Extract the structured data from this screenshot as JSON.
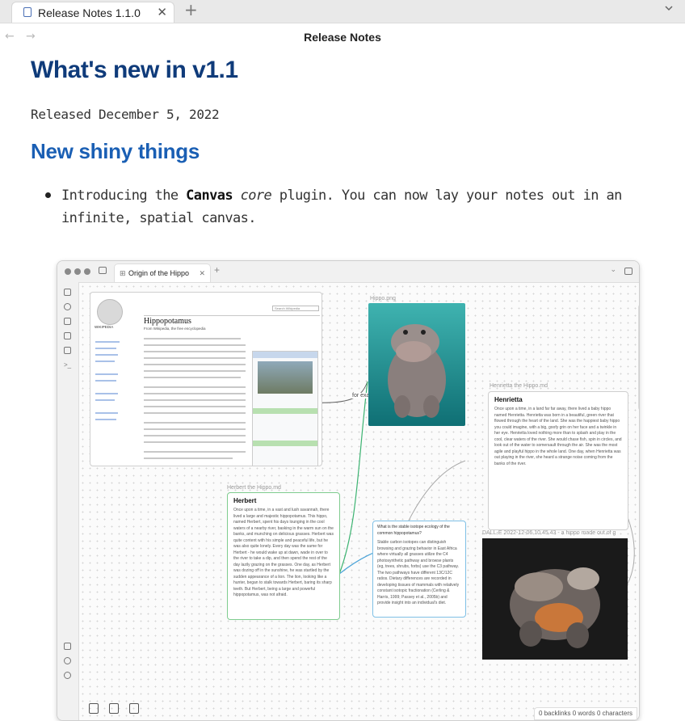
{
  "tab": {
    "title": "Release Notes 1.1.0",
    "close": "✕",
    "new": "+"
  },
  "nav": {
    "back": "←",
    "forward": "→",
    "view_title": "Release Notes"
  },
  "doc": {
    "h1": "What's new in v1.1",
    "released": "Released December 5, 2022",
    "h2": "New shiny things",
    "bullet_pre": "Introducing the ",
    "bullet_bold": "Canvas",
    "bullet_italic": " core",
    "bullet_post": " plugin. You can now lay your notes out in an infinite, spatial canvas."
  },
  "screenshot": {
    "tab_title": "Origin of the Hippo",
    "wiki": {
      "article": "Hippopotamus",
      "subtitle": "From Wikipedia, the free encyclopedia",
      "logo_text": "WIKIPEDIA",
      "search_placeholder": "Search Wikipedia"
    },
    "hippo_png_label": "Hippo.png",
    "edge_label": "for example",
    "henrietta": {
      "file_label": "Henrietta the Hippo.md",
      "heading": "Henrietta",
      "body": "Once upon a time, in a land far far away, there lived a baby hippo named Henrietta. Henrietta was born in a beautiful, green river that flowed through the heart of the land. She was the happiest baby hippo you could imagine, with a big, goofy grin on her face and a twinkle in her eye. Henrietta loved nothing more than to splash and play in the cool, clear waters of the river. She would chase fish, spin in circles, and look out of the water to somersault through the air. She was the most agile and playful hippo in the whole land. One day, when Henrietta was out playing in the river, she heard a strange noise coming from the banks of the river."
    },
    "herbert": {
      "file_label": "Herbert the Hippo.md",
      "heading": "Herbert",
      "body": "Once upon a time, in a vast and lush savannah, there lived a large and majestic hippopotamus. This hippo, named Herbert, spent his days lounging in the cool waters of a nearby river, basking in the warm sun on the banks, and munching on delicious grasses. Herbert was quite content with his simple and peaceful life, but he was also quite lonely. Every day was the same for Herbert - he would wake up at dawn, wade in over to the river to take a dip, and then spend the rest of the day lazily grazing on the grasses. One day, as Herbert was dozing off in the sunshine, he was startled by the sudden appearance of a lion. The lion, looking like a hunter, began to stalk towards Herbert, baring its sharp teeth. But Herbert, being a large and powerful hippopotamus, was not afraid."
    },
    "question": {
      "heading": "What is the stable isotope ecology of the common hippopotamus?",
      "body": "Stable carbon isotopes can distinguish browsing and grazing behavior in East Africa where virtually all grasses utilize the C4 photosynthetic pathway and browse plants (eg, trees, shrubs, forbs) use the C3 pathway. The two pathways have different 13C/12C ratios. Dietary differences are recorded in developing tissues of mammals with relatively constant isotopic fractionation (Cerling & Harris, 1999; Passey et al., 2005b) and provide insight into an individual's diet."
    },
    "dalle_label": "DALL-E 2022-12-06 10.45.43 - a hippo made out of g",
    "status": "0 backlinks   0 words   0 characters"
  },
  "colors": {
    "h1": "#0f3b7a",
    "h2": "#1a5fb4",
    "green_edge": "#3cb371",
    "blue_edge": "#4aa3d8"
  }
}
